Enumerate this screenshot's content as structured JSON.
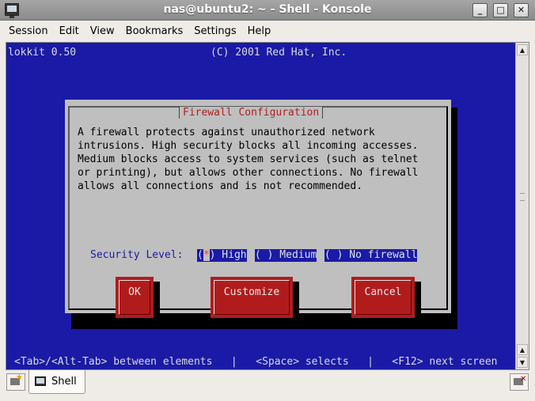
{
  "window": {
    "title": "nas@ubuntu2: ~ - Shell - Konsole"
  },
  "menu": [
    "Session",
    "Edit",
    "View",
    "Bookmarks",
    "Settings",
    "Help"
  ],
  "terminal": {
    "header_left": "lokkit 0.50",
    "header_center": "(C) 2001 Red Hat, Inc.",
    "dialog": {
      "title": "Firewall Configuration",
      "paragraph": "A firewall protects against unauthorized network\nintrusions. High security blocks all incoming accesses.\nMedium blocks access to system services (such as telnet\nor printing), but allows other connections. No firewall\nallows all connections and is not recommended.",
      "security_label": "Security Level:",
      "options": [
        {
          "open": "(",
          "mark": "*",
          "close": ") High",
          "selected": true
        },
        {
          "open": "(",
          "mark": " ",
          "close": ") Medium",
          "selected": false
        },
        {
          "open": "(",
          "mark": " ",
          "close": ") No firewall",
          "selected": false
        }
      ],
      "buttons": {
        "ok": "OK",
        "customize": "Customize",
        "cancel": "Cancel"
      }
    },
    "footer": "<Tab>/<Alt-Tab> between elements   |   <Space> selects   |   <F12> next screen"
  },
  "tabs": [
    {
      "label": "Shell",
      "active": true
    }
  ],
  "icons": {
    "app": "terminal-icon",
    "new_tab": "new-session-icon",
    "close_tab": "close-session-icon",
    "tab": "terminal-icon"
  },
  "colors": {
    "terminal_bg": "#1a1aa6",
    "dialog_bg": "#bfbfbf",
    "button_bg": "#b01c1c",
    "dialog_title": "#b22020"
  }
}
